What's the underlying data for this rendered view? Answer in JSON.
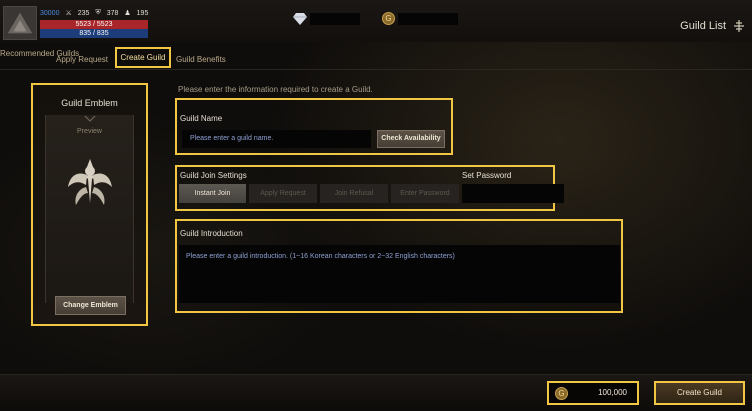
{
  "player": {
    "level": "30000",
    "stat_a": "235",
    "stat_b": "378",
    "stat_c": "195",
    "hp": "5523 / 5523",
    "mp": "835 / 835"
  },
  "header": {
    "guild_list_label": "Guild List"
  },
  "tabs": [
    {
      "label": "Recommended Guilds"
    },
    {
      "label": "Apply Request"
    },
    {
      "label": "Create Guild"
    },
    {
      "label": "Guild Benefits"
    }
  ],
  "emblem": {
    "title": "Guild Emblem",
    "preview_label": "Preview",
    "change_button": "Change Emblem"
  },
  "form": {
    "intro_text": "Please enter the information required to create a Guild.",
    "name_label": "Guild Name",
    "name_placeholder": "Please enter a guild name.",
    "check_button": "Check Availability",
    "join_label": "Guild Join Settings",
    "join_options": [
      "Instant Join",
      "Apply Request",
      "Join Refusal",
      "Enter Password"
    ],
    "password_label": "Set Password",
    "intro_label": "Guild Introduction",
    "intro_placeholder": "Please enter a guild introduction. (1~16 Korean characters or 2~32 English characters)"
  },
  "footer": {
    "cost": "100,000",
    "create_button": "Create Guild"
  },
  "colors": {
    "highlight": "#f1c642",
    "placeholder_text": "#8fa1d4"
  }
}
